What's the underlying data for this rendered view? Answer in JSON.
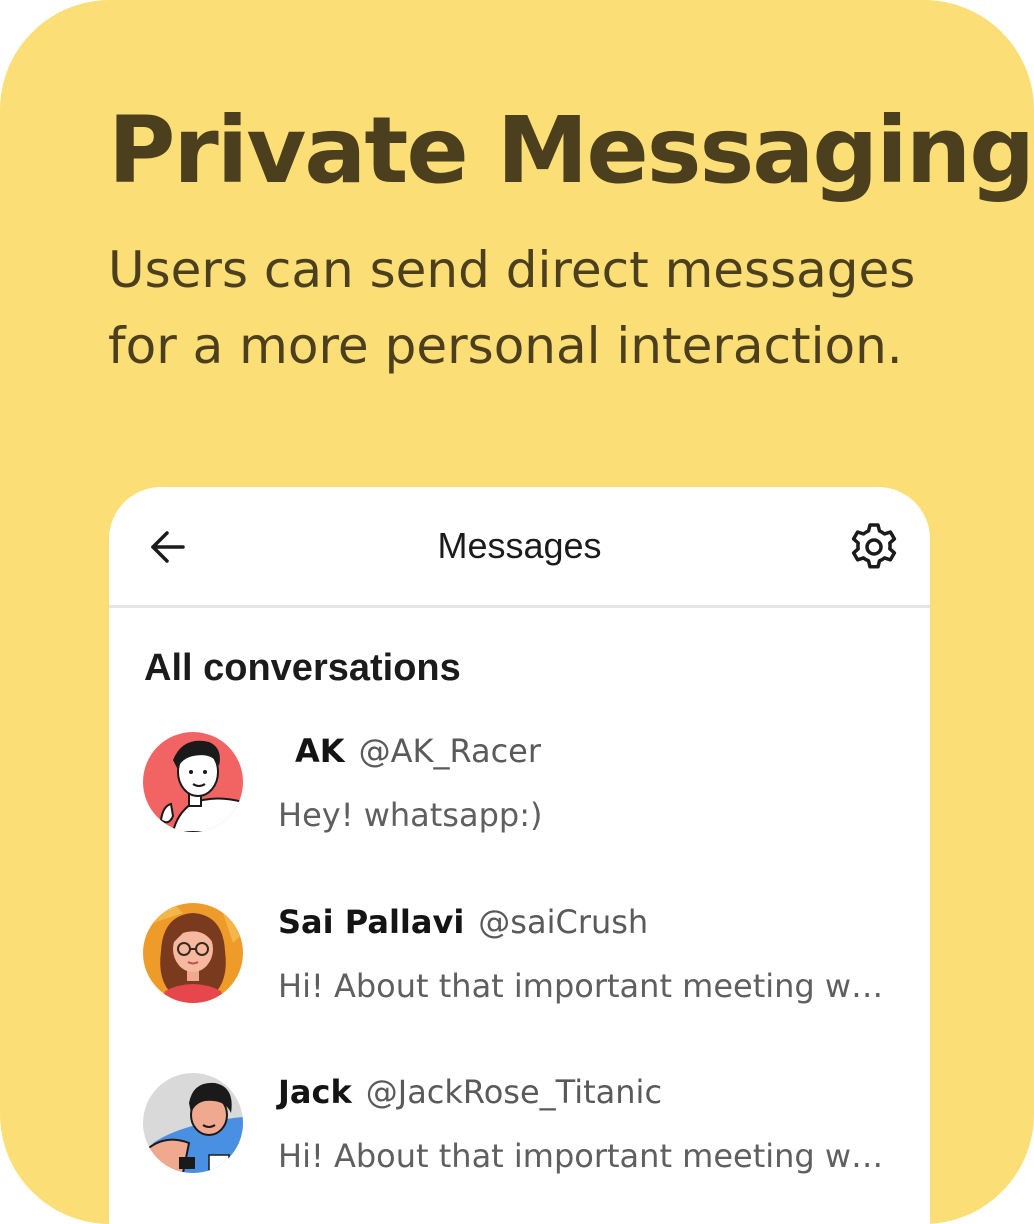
{
  "hero": {
    "title": "Private Messaging",
    "subtitle": "Users can send direct messages for a more personal interaction."
  },
  "app": {
    "title": "Messages",
    "back_icon": "arrow-left-icon",
    "settings_icon": "gear-icon",
    "section_title": "All conversations",
    "conversations": [
      {
        "name": "AK",
        "handle": "@AK_Racer",
        "preview": "Hey! whatsapp:)",
        "avatar_bg": "#f26464"
      },
      {
        "name": "Sai Pallavi",
        "handle": "@saiCrush",
        "preview": "Hi! About that important meeting we had yesterday",
        "avatar_bg": "#ee9b2a"
      },
      {
        "name": "Jack",
        "handle": "@JackRose_Titanic",
        "preview": "Hi! About that important meeting we had yesterday",
        "avatar_bg": "#d9d9d9"
      }
    ]
  },
  "colors": {
    "card_bg": "#fcde77",
    "headline": "#4b3f1d",
    "phone_bg": "#ffffff",
    "divider": "#e4e4ea"
  }
}
